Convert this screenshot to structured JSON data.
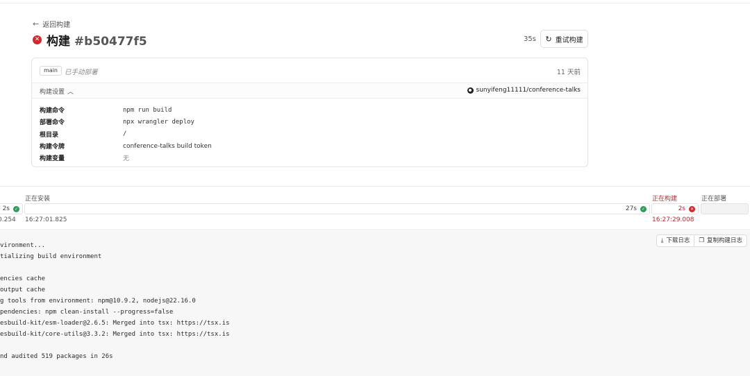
{
  "nav": {
    "back_label": "返回构建"
  },
  "header": {
    "title_prefix": "构建",
    "build_id": "#b50477f5",
    "duration": "35s",
    "retry_label": "重试构建"
  },
  "card": {
    "branch": "main",
    "deploy_type": "已手动部署",
    "time_ago": "11 天前",
    "settings_label": "构建设置",
    "repo": "sunyifeng11111/conference-talks",
    "settings": [
      {
        "key": "构建命令",
        "value": "npm run build",
        "mono": true
      },
      {
        "key": "部署命令",
        "value": "npx wrangler deploy",
        "mono": true
      },
      {
        "key": "根目录",
        "value": "/",
        "mono": true
      },
      {
        "key": "构建令牌",
        "value": "conference-talks build token",
        "mono": false
      },
      {
        "key": "构建变量",
        "value": "无",
        "mono": false
      }
    ]
  },
  "stages": {
    "first": {
      "duration": "2s",
      "time": "0.254"
    },
    "install": {
      "label": "正在安装",
      "duration": "27s",
      "time": "16:27:01.825"
    },
    "build": {
      "label": "正在构建",
      "duration": "2s",
      "time": "16:27:29.008"
    },
    "deploy": {
      "label": "正在部署"
    }
  },
  "log": {
    "download_label": "下载日志",
    "copy_label": "复制构建日志",
    "lines": [
      "vironment...",
      "tializing build environment",
      "",
      "encies cache",
      "output cache",
      "g tools from environment: npm@10.9.2, nodejs@22.16.0",
      "pendencies: npm clean-install --progress=false",
      "esbuild-kit/esm-loader@2.6.5: Merged into tsx: https://tsx.is",
      "esbuild-kit/core-utils@3.3.2: Merged into tsx: https://tsx.is",
      "",
      "nd audited 519 packages in 26s"
    ]
  },
  "colors": {
    "error": "#d7262b",
    "success": "#2e9c5a"
  }
}
